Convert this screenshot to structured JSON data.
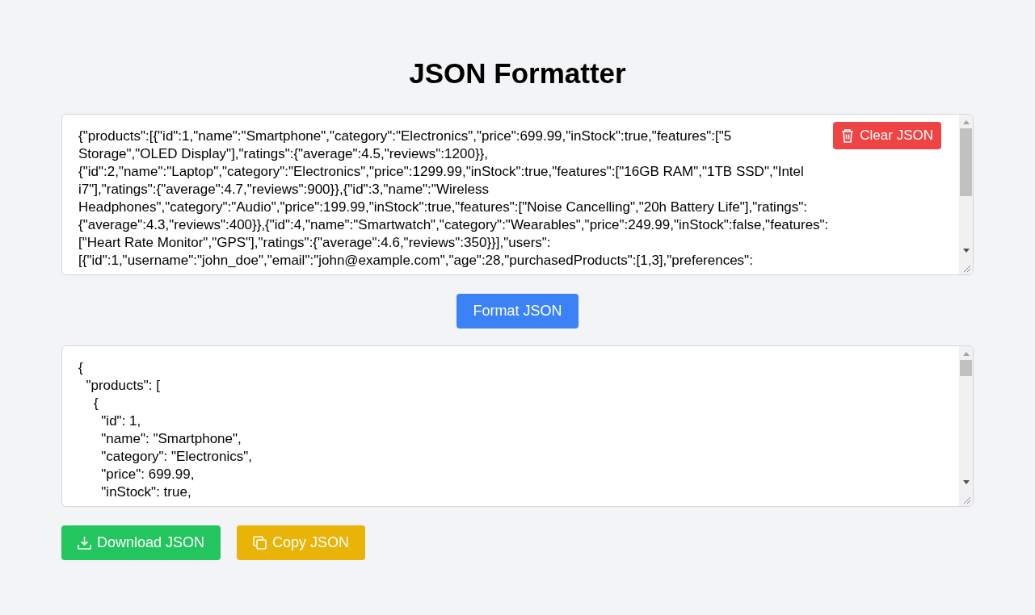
{
  "title": "JSON Formatter",
  "input": {
    "lines": [
      "{\"products\":[{\"id\":1,\"name\":\"Smartphone\",\"category\":\"Electronics\",\"price\":699.99,\"inStock\":true,\"features\":[\"5",
      "Storage\",\"OLED Display\"],\"ratings\":{\"average\":4.5,\"reviews\":1200}},",
      "{\"id\":2,\"name\":\"Laptop\",\"category\":\"Electronics\",\"price\":1299.99,\"inStock\":true,\"features\":[\"16GB RAM\",\"1TB SSD\",\"Intel",
      "i7\"],\"ratings\":{\"average\":4.7,\"reviews\":900}},{\"id\":3,\"name\":\"Wireless",
      "Headphones\",\"category\":\"Audio\",\"price\":199.99,\"inStock\":true,\"features\":[\"Noise Cancelling\",\"20h Battery Life\"],\"ratings\":",
      "{\"average\":4.3,\"reviews\":400}},{\"id\":4,\"name\":\"Smartwatch\",\"category\":\"Wearables\",\"price\":249.99,\"inStock\":false,\"features\":",
      "[\"Heart Rate Monitor\",\"GPS\"],\"ratings\":{\"average\":4.6,\"reviews\":350}}],\"users\":",
      "[{\"id\":1,\"username\":\"john_doe\",\"email\":\"john@example.com\",\"age\":28,\"purchasedProducts\":[1,3],\"preferences\":"
    ]
  },
  "clear_button": "Clear JSON",
  "format_button": "Format JSON",
  "output": {
    "lines": [
      "{",
      "  \"products\": [",
      "    {",
      "      \"id\": 1,",
      "      \"name\": \"Smartphone\",",
      "      \"category\": \"Electronics\",",
      "      \"price\": 699.99,",
      "      \"inStock\": true,"
    ]
  },
  "download_button": "Download JSON",
  "copy_button": "Copy JSON"
}
